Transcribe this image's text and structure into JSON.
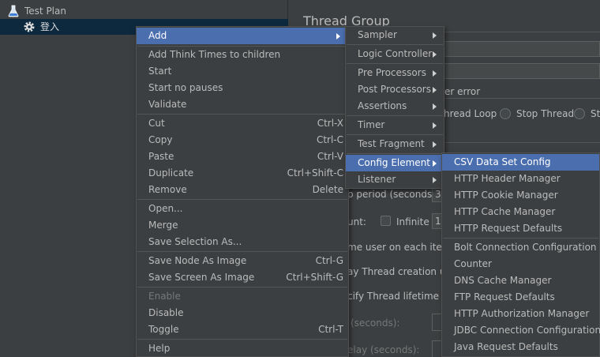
{
  "tree": {
    "items": [
      {
        "label": "Test Plan",
        "icon": "flask-icon"
      },
      {
        "label": "登入",
        "icon": "gear-icon"
      }
    ]
  },
  "panel": {
    "title": "Thread Group",
    "on_error_label": "er error",
    "radio_labels": [
      "hread Loop",
      "Stop Thread",
      "St"
    ],
    "ramp_label": "p period (seconds):",
    "ramp_value": "3",
    "loop_label": "unt:",
    "infinite_label": "Infinite",
    "loop_value": "1",
    "same_user_label": "me user on each iteratio",
    "delay_label": "ay Thread creation unti",
    "specify_label": "cify Thread lifetime",
    "duration_label": "(seconds):",
    "startup_label": "elay (seconds):"
  },
  "context_menu": {
    "add": "Add",
    "add_think_times": "Add Think Times to children",
    "start": "Start",
    "start_no_pauses": "Start no pauses",
    "validate": "Validate",
    "cut": "Cut",
    "cut_key": "Ctrl-X",
    "copy": "Copy",
    "copy_key": "Ctrl-C",
    "paste": "Paste",
    "paste_key": "Ctrl-V",
    "duplicate": "Duplicate",
    "duplicate_key": "Ctrl+Shift-C",
    "remove": "Remove",
    "remove_key": "Delete",
    "open": "Open...",
    "merge": "Merge",
    "save_selection_as": "Save Selection As...",
    "save_node_as_image": "Save Node As Image",
    "save_node_key": "Ctrl-G",
    "save_screen_as_image": "Save Screen As Image",
    "save_screen_key": "Ctrl+Shift-G",
    "enable": "Enable",
    "disable": "Disable",
    "toggle": "Toggle",
    "toggle_key": "Ctrl-T",
    "help": "Help"
  },
  "add_submenu": {
    "sampler": "Sampler",
    "logic_controller": "Logic Controller",
    "pre_processors": "Pre Processors",
    "post_processors": "Post Processors",
    "assertions": "Assertions",
    "timer": "Timer",
    "test_fragment": "Test Fragment",
    "config_element": "Config Element",
    "listener": "Listener"
  },
  "config_submenu": {
    "items": [
      "CSV Data Set Config",
      "HTTP Header Manager",
      "HTTP Cookie Manager",
      "HTTP Cache Manager",
      "HTTP Request Defaults",
      "Bolt Connection Configuration",
      "Counter",
      "DNS Cache Manager",
      "FTP Request Defaults",
      "HTTP Authorization Manager",
      "JDBC Connection Configuration",
      "Java Request Defaults"
    ]
  },
  "colors": {
    "background": "#3c3f41",
    "selection": "#4b6eaf",
    "tree_selection": "#0d293e",
    "text": "#bbbbbb"
  }
}
